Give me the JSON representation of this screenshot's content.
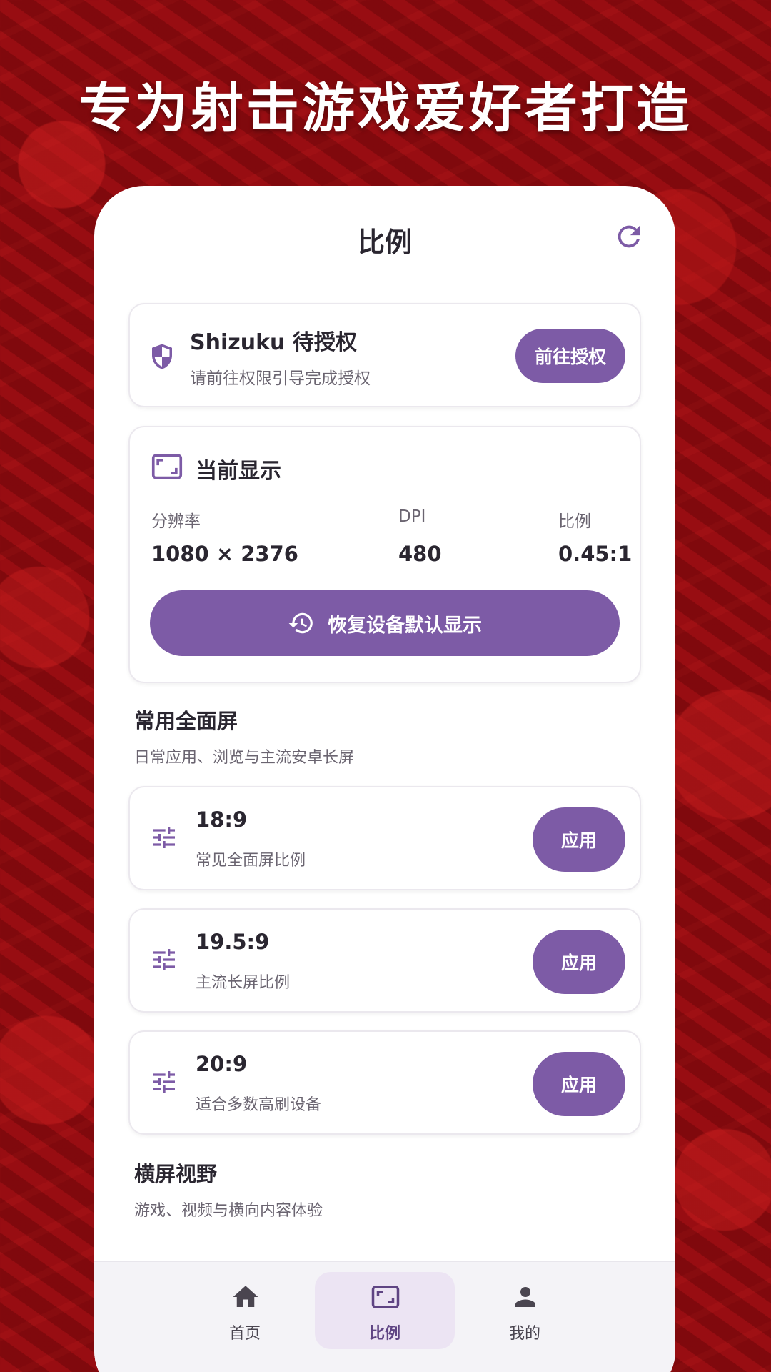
{
  "headline": "专为射击游戏爱好者打造",
  "app": {
    "title": "比例"
  },
  "auth": {
    "title": "Shizuku 待授权",
    "subtitle": "请前往权限引导完成授权",
    "button": "前往授权"
  },
  "current_display": {
    "heading": "当前显示",
    "resolution_label": "分辨率",
    "resolution_value": "1080 × 2376",
    "dpi_label": "DPI",
    "dpi_value": "480",
    "ratio_label": "比例",
    "ratio_value": "0.45:1",
    "restore_button": "恢复设备默认显示"
  },
  "fullscreen_section": {
    "title": "常用全面屏",
    "subtitle": "日常应用、浏览与主流安卓长屏",
    "items": [
      {
        "ratio": "18:9",
        "desc": "常见全面屏比例",
        "button": "应用"
      },
      {
        "ratio": "19.5:9",
        "desc": "主流长屏比例",
        "button": "应用"
      },
      {
        "ratio": "20:9",
        "desc": "适合多数高刷设备",
        "button": "应用"
      }
    ]
  },
  "landscape_section": {
    "title": "横屏视野",
    "subtitle": "游戏、视频与横向内容体验"
  },
  "bottom_nav": [
    {
      "label": "首页",
      "icon": "home-icon",
      "active": false
    },
    {
      "label": "比例",
      "icon": "aspect-ratio-icon",
      "active": true
    },
    {
      "label": "我的",
      "icon": "person-icon",
      "active": false
    }
  ],
  "colors": {
    "accent": "#7d5ba6",
    "background": "#8c0a0e",
    "nav_active_bg": "#ece4f3"
  }
}
